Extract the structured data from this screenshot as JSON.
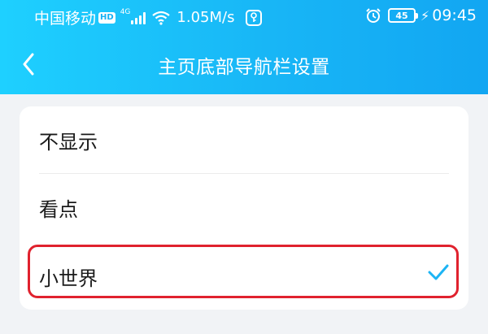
{
  "status_bar": {
    "carrier": "中国移动",
    "hd": "HD",
    "network": "4G",
    "speed": "1.05M/s",
    "vpn_icon": "vpn-key-icon",
    "battery": "45",
    "time": "09:45"
  },
  "nav": {
    "title": "主页底部导航栏设置",
    "back_icon": "chevron-left-icon"
  },
  "options": [
    {
      "label": "不显示",
      "selected": false
    },
    {
      "label": "看点",
      "selected": false
    },
    {
      "label": "小世界",
      "selected": true
    }
  ],
  "colors": {
    "header_start": "#1ed0ff",
    "header_end": "#12a6f2",
    "check": "#1cb4f4",
    "highlight_border": "#e0222e",
    "background": "#f1f3f6"
  }
}
